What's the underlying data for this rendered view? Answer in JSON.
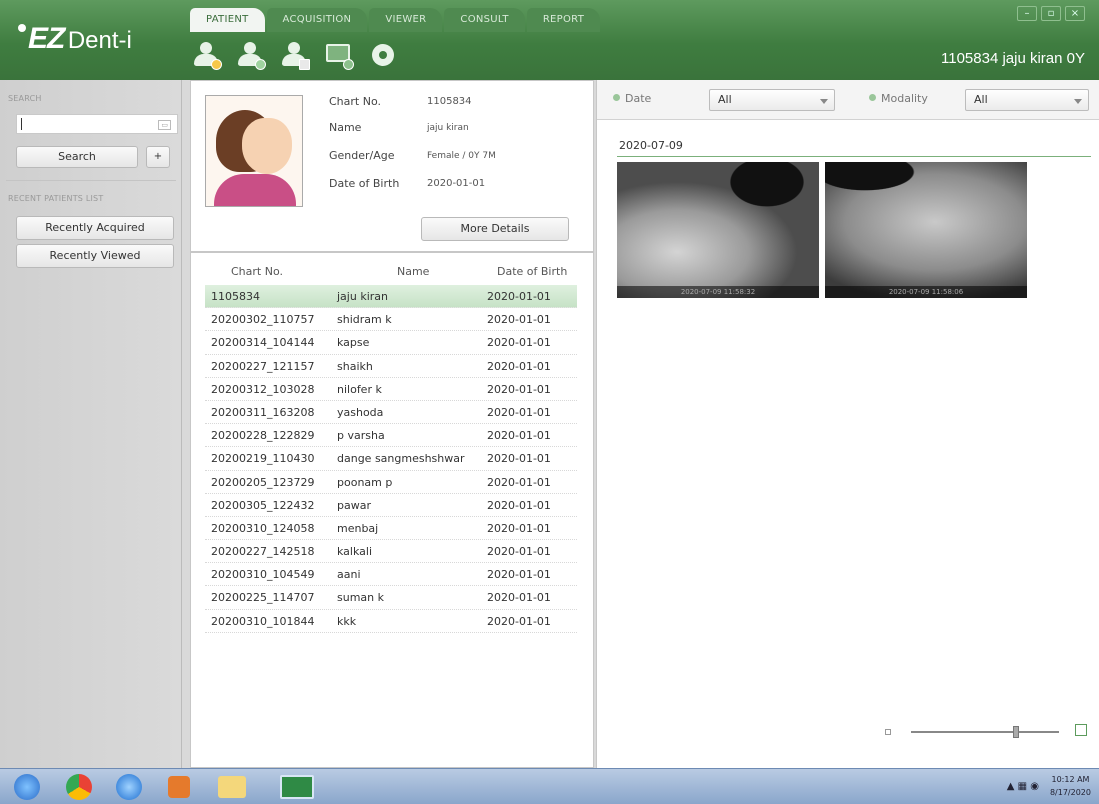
{
  "app": {
    "logo_ez": "EZ",
    "logo_dent": "Dent-i",
    "current_patient": "1105834 jaju kiran  0Y"
  },
  "tabs": [
    "PATIENT",
    "ACQUISITION",
    "VIEWER",
    "CONSULT",
    "REPORT"
  ],
  "toolbar_icons": [
    "new-patient-icon",
    "edit-patient-icon",
    "delete-patient-icon",
    "import-image-icon",
    "radiation-icon"
  ],
  "sidebar": {
    "search_label": "SEARCH",
    "search_value": "",
    "search_button": "Search",
    "add_button": "+",
    "recent_label": "RECENT PATIENTS LIST",
    "recently_acquired": "Recently Acquired",
    "recently_viewed": "Recently Viewed"
  },
  "patient_info": {
    "chart_label": "Chart No.",
    "chart_value": "1105834",
    "name_label": "Name",
    "name_value": "jaju kiran",
    "gender_label": "Gender/Age",
    "gender_value": "Female / 0Y 7M",
    "dob_label": "Date of Birth",
    "dob_value": "2020-01-01",
    "more_details": "More Details"
  },
  "patient_list": {
    "headers": [
      "Chart No.",
      "Name",
      "Date of Birth"
    ],
    "rows": [
      [
        "1105834",
        "jaju kiran",
        "2020-01-01"
      ],
      [
        "20200302_110757",
        "shidram k",
        "2020-01-01"
      ],
      [
        "20200314_104144",
        "kapse",
        "2020-01-01"
      ],
      [
        "20200227_121157",
        "shaikh",
        "2020-01-01"
      ],
      [
        "20200312_103028",
        "nilofer k",
        "2020-01-01"
      ],
      [
        "20200311_163208",
        "yashoda",
        "2020-01-01"
      ],
      [
        "20200228_122829",
        "p varsha",
        "2020-01-01"
      ],
      [
        "20200219_110430",
        "dange sangmeshshwar",
        "2020-01-01"
      ],
      [
        "20200205_123729",
        "poonam p",
        "2020-01-01"
      ],
      [
        "20200305_122432",
        "pawar",
        "2020-01-01"
      ],
      [
        "20200310_124058",
        " menbaj",
        "2020-01-01"
      ],
      [
        "20200227_142518",
        "kalkali",
        "2020-01-01"
      ],
      [
        "20200310_104549",
        " aani",
        "2020-01-01"
      ],
      [
        "20200225_114707",
        "suman k",
        "2020-01-01"
      ],
      [
        "20200310_101844",
        "kkk",
        "2020-01-01"
      ]
    ]
  },
  "image_panel": {
    "date_label": "Date",
    "date_value": "All",
    "modality_label": "Modality",
    "modality_value": "All",
    "group_date": "2020-07-09",
    "thumb1_stamp": "2020-07-09 11:58:32",
    "thumb2_stamp": "2020-07-09 11:58:06",
    "zoom_level": 0.72
  },
  "taskbar": {
    "time": "10:12 AM",
    "date": "8/17/2020"
  },
  "colors": {
    "brand_green": "#3f7d40",
    "selection": "#c6e2c6"
  }
}
